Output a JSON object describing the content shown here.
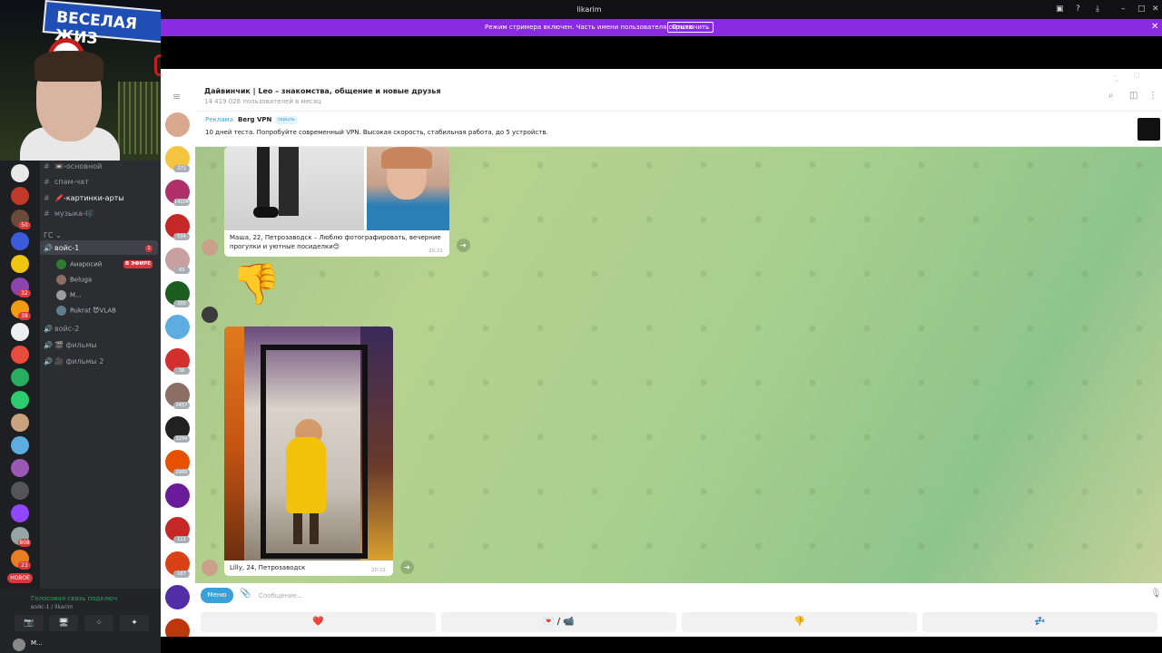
{
  "webcam": {
    "sign_text": "ВЕСЕЛАЯ ЖИЗ"
  },
  "discord": {
    "servers": [
      {
        "color": "#e8e8e8"
      },
      {
        "color": "#c0392b"
      },
      {
        "color": "#6b4a3a",
        "badge": "50"
      },
      {
        "color": "#3b5bdb"
      },
      {
        "color": "#f1c40f"
      },
      {
        "color": "#8e44ad",
        "badge": "32"
      },
      {
        "color": "#f39c12",
        "badge": "38"
      },
      {
        "color": "#ecf0f1"
      },
      {
        "color": "#e74c3c"
      },
      {
        "color": "#27ae60"
      },
      {
        "color": "#2ecc71"
      },
      {
        "color": "#c9a27e"
      },
      {
        "color": "#5dade2"
      },
      {
        "color": "#9b59b6"
      },
      {
        "color": "#555555"
      },
      {
        "color": "#9146ff"
      },
      {
        "color": "#95a5a6",
        "badge": "808"
      },
      {
        "color": "#e67e22",
        "badge": "23"
      }
    ],
    "new_badge": "НОВОЕ",
    "channels": [
      {
        "sym": "#",
        "label": "📼-основной"
      },
      {
        "sym": "#",
        "label": "спам-чат"
      },
      {
        "sym": "#",
        "label": "🖍️-картинки-арты"
      },
      {
        "sym": "#",
        "label": "музыка-🎼"
      }
    ],
    "category": "ГС ⌄",
    "voice1": {
      "label": "войс-1",
      "count": "1"
    },
    "voice_users": [
      {
        "name": "Аиаросий",
        "color": "#2e7d32"
      },
      {
        "name": "Beluga",
        "color": "#8d6e63"
      },
      {
        "name": "M...",
        "color": "#9e9e9e"
      },
      {
        "name": "Rukrat 😈VLAB",
        "color": "#607d8b"
      }
    ],
    "live_badge": "В ЭФИРЕ",
    "voice_channels": [
      {
        "label": "войс-2"
      },
      {
        "label": "🎬 фильмы"
      },
      {
        "label": "🎥 фильмы 2"
      }
    ],
    "voice_status": "Голосовая связь подключ",
    "voice_sub": "войс-1 / likarim",
    "buttons": [
      "📷",
      "🖥",
      "⁘",
      "✦"
    ],
    "me_name": "M..."
  },
  "browser": {
    "title": "likarim",
    "streamer_text": "Режим стримера включен. Часть имени пользователя скрыта.",
    "streamer_button": "Отключить",
    "close": "✕"
  },
  "telegram": {
    "chat_title": "Дайвинчик | Leo – знакомства, общение и новые друзья",
    "chat_subtitle": "14 419 026 пользователей в месяц",
    "ad": {
      "label": "Реклама",
      "name": "Berg VPN",
      "hide": "скрыть",
      "text": "10 дней теста. Попробуйте современный VPN. Высокая скорость, стабильная работа, до 5 устройств."
    },
    "chats": [
      {
        "color": "#d9a98f",
        "count": ""
      },
      {
        "color": "#f5c542",
        "count": "373"
      },
      {
        "color": "#b0306a",
        "count": "14104"
      },
      {
        "color": "#c62828",
        "count": "534"
      },
      {
        "color": "#c9a0a0",
        "count": "43"
      },
      {
        "color": "#1b5e20",
        "count": "200"
      },
      {
        "color": "#5dade2",
        "count": ""
      },
      {
        "color": "#d32f2f",
        "count": "36"
      },
      {
        "color": "#8d6e63",
        "count": "2457"
      },
      {
        "color": "#212121",
        "count": "1294"
      },
      {
        "color": "#e65100",
        "count": "2400"
      },
      {
        "color": "#6a1b9a",
        "count": ""
      },
      {
        "color": "#c62828",
        "count": "111"
      },
      {
        "color": "#d84315",
        "count": "187"
      },
      {
        "color": "#512da8",
        "count": ""
      },
      {
        "color": "#bf360c",
        "count": ""
      }
    ],
    "messages": [
      {
        "caption": "Маша, 22, Петрозаводск – Люблю фотографировать, вечерние прогулки и уютные посиделки😊",
        "time": "20:21"
      },
      {
        "sticker": "👎"
      },
      {
        "caption": "Lilly, 24, Петрозаводск",
        "time": "20:22"
      }
    ],
    "composer": {
      "menu": "Меню",
      "placeholder": "Сообщение..."
    },
    "keyboard": [
      "❤️",
      "💌 / 📹",
      "👎",
      "💤"
    ]
  }
}
